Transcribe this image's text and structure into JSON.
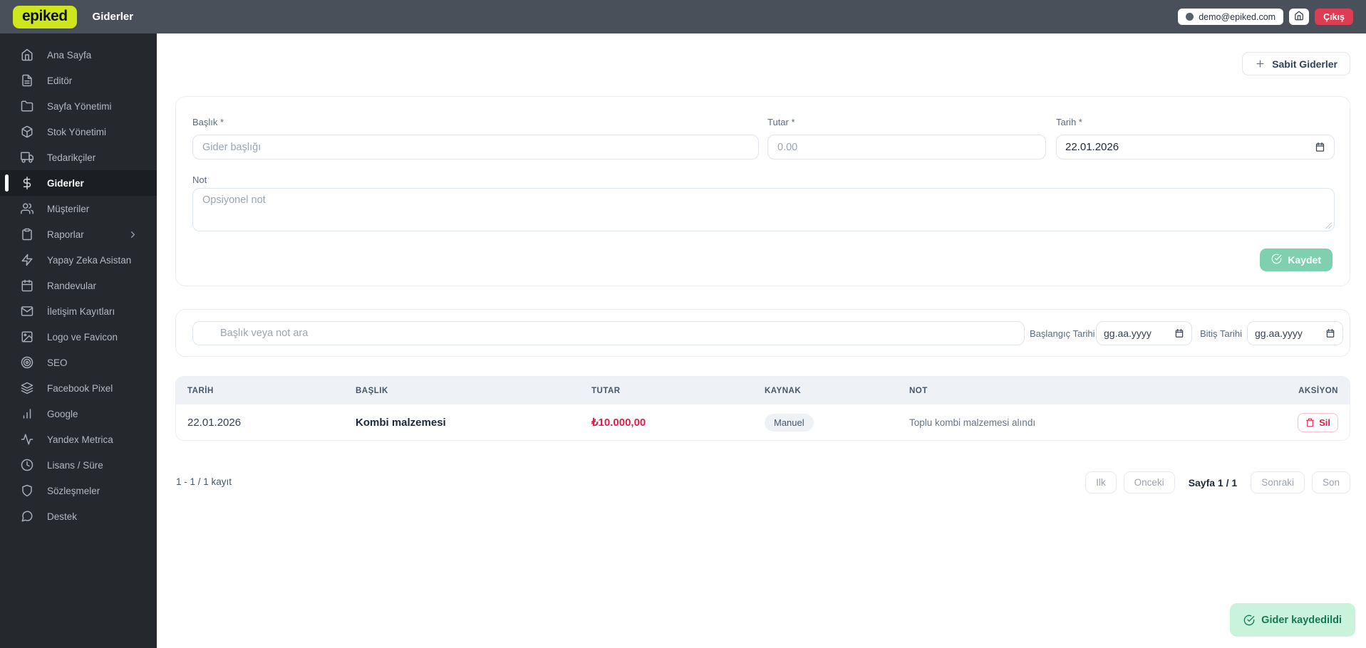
{
  "topbar": {
    "logo": "epiked",
    "title": "Giderler",
    "user_email": "demo@epiked.com",
    "logout_label": "Çıkış"
  },
  "sidebar": {
    "items": [
      {
        "label": "Ana Sayfa",
        "icon": "home",
        "active": false,
        "chevron": false
      },
      {
        "label": "Editör",
        "icon": "file-text",
        "active": false,
        "chevron": false
      },
      {
        "label": "Sayfa Yönetimi",
        "icon": "folder",
        "active": false,
        "chevron": false
      },
      {
        "label": "Stok Yönetimi",
        "icon": "package",
        "active": false,
        "chevron": false
      },
      {
        "label": "Tedarikçiler",
        "icon": "truck",
        "active": false,
        "chevron": false
      },
      {
        "label": "Giderler",
        "icon": "dollar",
        "active": true,
        "chevron": false
      },
      {
        "label": "Müşteriler",
        "icon": "users",
        "active": false,
        "chevron": false
      },
      {
        "label": "Raporlar",
        "icon": "clipboard",
        "active": false,
        "chevron": true
      },
      {
        "label": "Yapay Zeka Asistan",
        "icon": "zap",
        "active": false,
        "chevron": false
      },
      {
        "label": "Randevular",
        "icon": "calendar",
        "active": false,
        "chevron": false
      },
      {
        "label": "İletişim Kayıtları",
        "icon": "mail",
        "active": false,
        "chevron": false
      },
      {
        "label": "Logo ve Favicon",
        "icon": "image",
        "active": false,
        "chevron": false
      },
      {
        "label": "SEO",
        "icon": "target",
        "active": false,
        "chevron": false
      },
      {
        "label": "Facebook Pixel",
        "icon": "layers",
        "active": false,
        "chevron": false
      },
      {
        "label": "Google",
        "icon": "bar-chart",
        "active": false,
        "chevron": false
      },
      {
        "label": "Yandex Metrica",
        "icon": "activity",
        "active": false,
        "chevron": false
      },
      {
        "label": "Lisans / Süre",
        "icon": "clock",
        "active": false,
        "chevron": false
      },
      {
        "label": "Sözleşmeler",
        "icon": "shield",
        "active": false,
        "chevron": false
      },
      {
        "label": "Destek",
        "icon": "message-circle",
        "active": false,
        "chevron": false
      }
    ]
  },
  "page": {
    "add_button_label": "Sabit Giderler",
    "form": {
      "title_label": "Başlık *",
      "title_placeholder": "Gider başlığı",
      "amount_label": "Tutar *",
      "amount_placeholder": "0.00",
      "date_label": "Tarih *",
      "date_value": "22.01.2026",
      "note_label": "Not",
      "note_placeholder": "Opsiyonel not",
      "save_label": "Kaydet"
    },
    "filters": {
      "search_placeholder": "Başlık veya not ara",
      "start_label": "Başlangıç Tarihi",
      "end_label": "Bitiş Tarihi",
      "date_placeholder": "gg.aa.yyyy"
    },
    "table": {
      "headers": [
        "TARİH",
        "BAŞLIK",
        "TUTAR",
        "KAYNAK",
        "NOT",
        "AKSİYON"
      ],
      "rows": [
        {
          "date": "22.01.2026",
          "title": "Kombi malzemesi",
          "amount": "₺10.000,00",
          "source": "Manuel",
          "note": "Toplu kombi malzemesi alındı",
          "action": "Sil"
        }
      ]
    },
    "pagination": {
      "summary": "1 - 1 / 1 kayıt",
      "first": "Ilk",
      "prev": "Onceki",
      "page_info": "Sayfa 1 / 1",
      "next": "Sonraki",
      "last": "Son"
    },
    "toast": {
      "message": "Gider kaydedildi"
    }
  },
  "colors": {
    "topbar_bg": "#4a505a",
    "sidebar_bg": "#25282c",
    "brand_lime": "#cde61e",
    "logout_red": "#dc3d52",
    "save_green": "#7ed0ae",
    "amount_red": "#e11d48",
    "toast_bg": "#c9f4db",
    "toast_text": "#177a4c"
  }
}
